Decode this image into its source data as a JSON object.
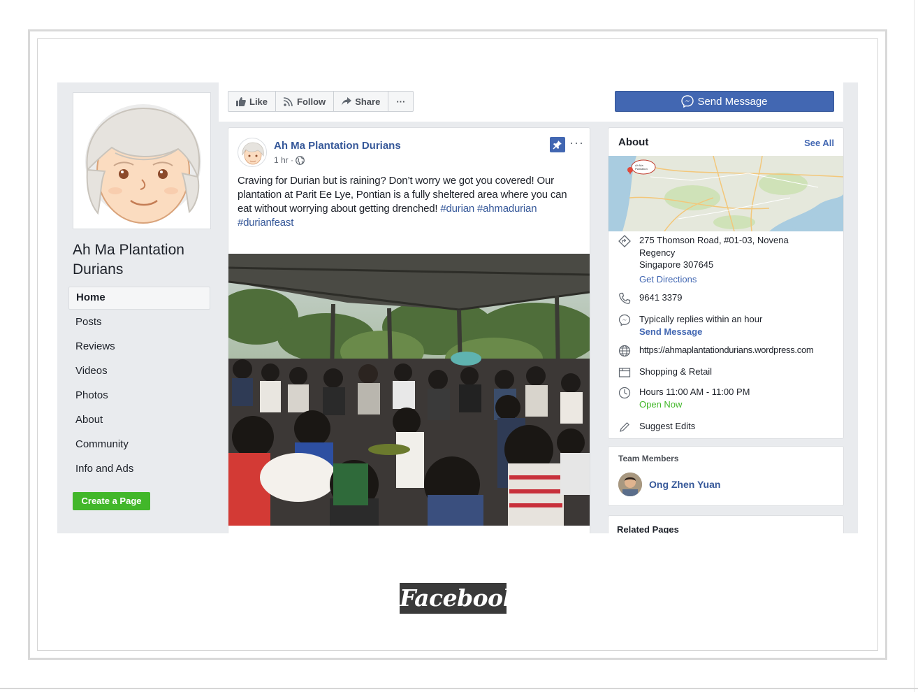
{
  "page": {
    "name": "Ah Ma Plantation Durians",
    "caption": "Facebook"
  },
  "sidebar": {
    "items": [
      {
        "label": "Home",
        "active": true
      },
      {
        "label": "Posts"
      },
      {
        "label": "Reviews"
      },
      {
        "label": "Videos"
      },
      {
        "label": "Photos"
      },
      {
        "label": "About"
      },
      {
        "label": "Community"
      },
      {
        "label": "Info and Ads"
      }
    ],
    "create_page": "Create a Page"
  },
  "actions": {
    "like": "Like",
    "follow": "Follow",
    "share": "Share",
    "more": "···",
    "send_message": "Send Message"
  },
  "post": {
    "author": "Ah Ma Plantation Durians",
    "time": "1 hr ·",
    "text": "Craving for Durian but is raining? Don’t worry we got you covered! Our plantation  at Parit Ee Lye, Pontian is a fully sheltered area where you can eat without worrying about getting drenched! ",
    "hashtags": [
      "#durian",
      "#ahmadurian",
      "#durianfeast"
    ],
    "more": "···"
  },
  "about": {
    "title": "About",
    "see_all": "See All",
    "map_label": "Ah Ma Plantation",
    "address_line1": "275 Thomson Road, #01-03, Novena",
    "address_line2": "Regency",
    "address_line3": "Singapore 307645",
    "get_directions": "Get Directions",
    "phone": "9641 3379",
    "reply_time": "Typically replies within an hour",
    "send_message": "Send Message",
    "website": "https://ahmaplantationdurians.wordpress.com",
    "category": "Shopping & Retail",
    "hours": "Hours 11:00 AM - 11:00 PM",
    "open_now": "Open Now",
    "suggest_edits": "Suggest Edits"
  },
  "team": {
    "title": "Team Members",
    "member": "Ong Zhen Yuan"
  },
  "related": {
    "title": "Related Pages"
  },
  "colors": {
    "facebook_blue": "#4267b2",
    "link_blue": "#365899",
    "green": "#42b72a",
    "background": "#e9ebee"
  }
}
